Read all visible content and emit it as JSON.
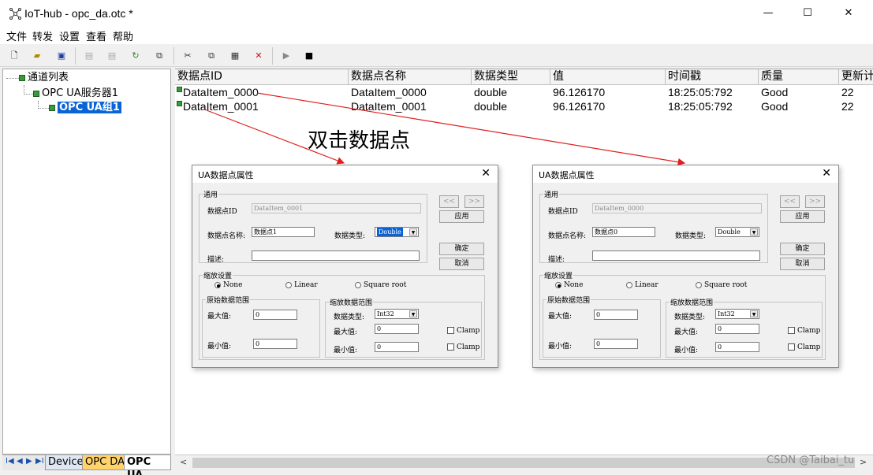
{
  "window": {
    "title": "IoT-hub - opc_da.otc *",
    "controls": {
      "minimize": "—",
      "maximize": "☐",
      "close": "✕"
    }
  },
  "menu": [
    "文件",
    "转发",
    "设置",
    "查看",
    "帮助"
  ],
  "toolbar": {
    "icons": [
      "new-icon",
      "open-icon",
      "save-icon",
      "disabled-1-icon",
      "disabled-2-icon",
      "refresh-icon",
      "export-icon",
      "cut-icon",
      "copy-icon",
      "paste-icon",
      "delete-icon",
      "run-icon",
      "stop-icon"
    ]
  },
  "tree": {
    "root": "通道列表",
    "server": "OPC UA服务器1",
    "group": "OPC UA组1"
  },
  "tabs": {
    "nav": [
      "I◀",
      "◀",
      "▶",
      "▶I"
    ],
    "items": [
      "Device",
      "OPC DA",
      "OPC UA"
    ]
  },
  "table": {
    "columns": [
      "数据点ID",
      "数据点名称",
      "数据类型",
      "值",
      "时间戳",
      "质量",
      "更新计"
    ],
    "rows": [
      {
        "id": "DataItem_0000",
        "name": "DataItem_0000",
        "type": "double",
        "value": "96.126170",
        "time": "18:25:05:792",
        "quality": "Good",
        "count": "22"
      },
      {
        "id": "DataItem_0001",
        "name": "DataItem_0001",
        "type": "double",
        "value": "96.126170",
        "time": "18:25:05:792",
        "quality": "Good",
        "count": "22"
      }
    ]
  },
  "annotation": {
    "text": "双击数据点",
    "color": "#e02020"
  },
  "dialogs": [
    {
      "title": "UA数据点属性",
      "close": "✕",
      "general_group": "通用",
      "id_label": "数据点ID",
      "id_value": "DataItem_0001",
      "name_label": "数据点名称:",
      "name_value": "数据点1",
      "type_label": "数据类型:",
      "type_value": "Double",
      "desc_label": "描述:",
      "desc_value": "",
      "prev": "<<",
      "next": ">>",
      "apply": "应用",
      "ok": "确定",
      "cancel": "取消",
      "scale_group": "缩放设置",
      "radio_none": "None",
      "radio_linear": "Linear",
      "radio_sqrt": "Square root",
      "raw_group": "原始数据范围",
      "raw_max_label": "最大值:",
      "raw_max": "0",
      "raw_min_label": "最小值:",
      "raw_min": "0",
      "scaled_group": "缩放数据范围",
      "scaled_type_label": "数据类型:",
      "scaled_type": "Int32",
      "scaled_max_label": "最大值:",
      "scaled_max": "0",
      "scaled_min_label": "最小值:",
      "scaled_min": "0",
      "clamp": "Clamp"
    },
    {
      "title": "UA数据点属性",
      "close": "✕",
      "general_group": "通用",
      "id_label": "数据点ID",
      "id_value": "DataItem_0000",
      "name_label": "数据点名称:",
      "name_value": "数据点0",
      "type_label": "数据类型:",
      "type_value": "Double",
      "desc_label": "描述:",
      "desc_value": "",
      "prev": "<<",
      "next": ">>",
      "apply": "应用",
      "ok": "确定",
      "cancel": "取消",
      "scale_group": "缩放设置",
      "radio_none": "None",
      "radio_linear": "Linear",
      "radio_sqrt": "Square root",
      "raw_group": "原始数据范围",
      "raw_max_label": "最大值:",
      "raw_max": "0",
      "raw_min_label": "最小值:",
      "raw_min": "0",
      "scaled_group": "缩放数据范围",
      "scaled_type_label": "数据类型:",
      "scaled_type": "Int32",
      "scaled_max_label": "最大值:",
      "scaled_max": "0",
      "scaled_min_label": "最小值:",
      "scaled_min": "0",
      "clamp": "Clamp"
    }
  ],
  "watermark": "CSDN @Taibai_tu"
}
